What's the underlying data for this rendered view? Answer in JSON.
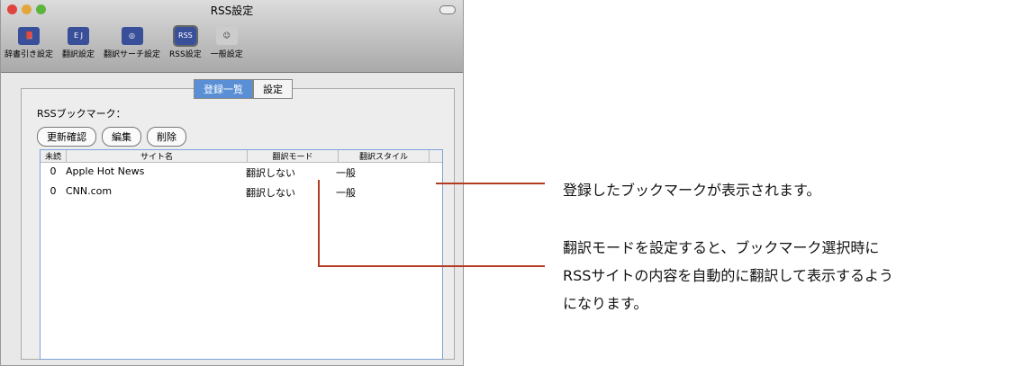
{
  "window": {
    "title": "RSS設定"
  },
  "toolbar": [
    {
      "label": "辞書引き設定",
      "icon": "dictionary-icon"
    },
    {
      "label": "翻訳設定",
      "icon": "ej-translate-icon"
    },
    {
      "label": "翻訳サーチ設定",
      "icon": "globe-search-icon"
    },
    {
      "label": "RSS設定",
      "icon": "rss-icon",
      "selected": true
    },
    {
      "label": "一般設定",
      "icon": "general-settings-icon"
    }
  ],
  "tabs": {
    "list": "登録一覧",
    "settings": "設定"
  },
  "section_label": "RSSブックマーク：",
  "buttons": {
    "update": "更新確認",
    "edit": "編集",
    "delete": "削除"
  },
  "table": {
    "headers": [
      "未読",
      "サイト名",
      "翻訳モード",
      "翻訳スタイル"
    ],
    "rows": [
      {
        "unread": "0",
        "site": "Apple Hot News",
        "mode": "翻訳しない",
        "style": "一般"
      },
      {
        "unread": "0",
        "site": "CNN.com",
        "mode": "翻訳しない",
        "style": "一般"
      }
    ]
  },
  "annotations": {
    "note1": "登録したブックマークが表示されます。",
    "note2_line1": "翻訳モードを設定すると、ブックマーク選択時に",
    "note2_line2": "RSSサイトの内容を自動的に翻訳して表示するよう",
    "note2_line3": "になります。"
  },
  "colors": {
    "callout": "#b33b22"
  }
}
